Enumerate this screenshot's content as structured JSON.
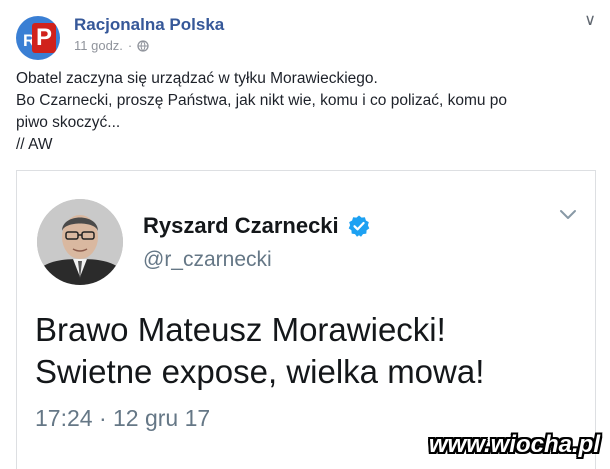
{
  "post": {
    "page_name": "Racjonalna Polska",
    "time": "11 godz.",
    "separator": "·",
    "avatar_letters": {
      "r": "R",
      "p": "P"
    },
    "chevron": "∨",
    "lines": [
      "Obatel zaczyna się urządzać w tyłku Morawieckiego.",
      "Bo Czarnecki, proszę Państwa, jak nikt wie, komu i co polizać, komu po",
      "piwo skoczyć...",
      "// AW"
    ]
  },
  "tweet": {
    "name": "Ryszard Czarnecki",
    "handle": "@r_czarnecki",
    "text_lines": [
      "Brawo Mateusz Morawiecki!",
      "Swietne expose, wielka mowa!"
    ],
    "timestamp": "17:24 · 12 gru 17"
  },
  "watermark": "www.wiocha.pl",
  "colors": {
    "link": "#365899",
    "verified": "#1da1f2",
    "muted": "#90949c"
  },
  "icons": [
    "globe-icon",
    "verified-badge-icon",
    "chevron-down-icon"
  ]
}
